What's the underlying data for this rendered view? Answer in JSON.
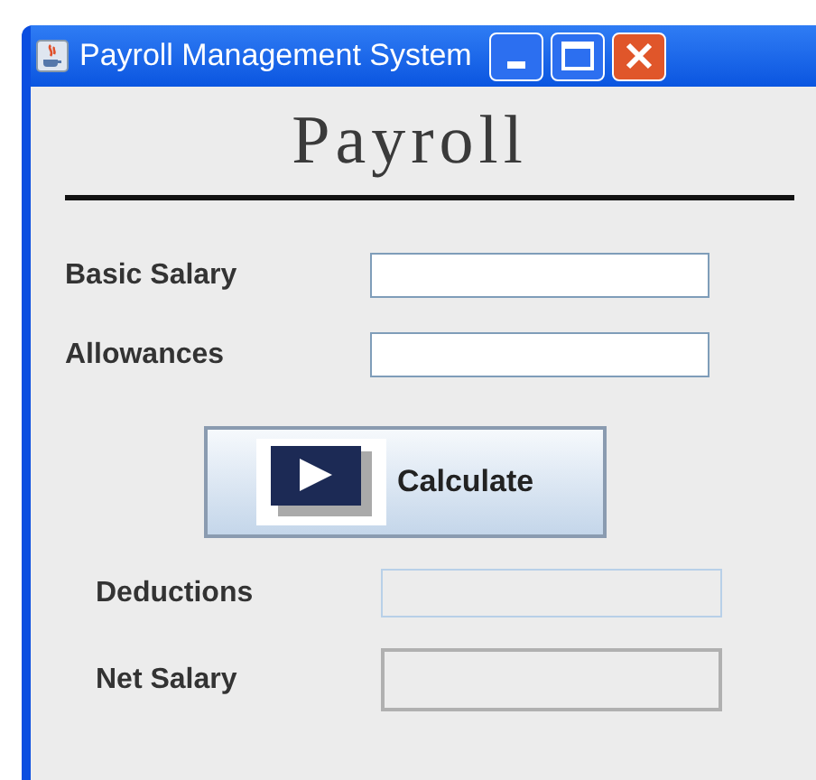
{
  "window": {
    "title": "Payroll Management System"
  },
  "heading": "Payroll",
  "inputs": [
    {
      "label": "Basic Salary",
      "editable": true
    },
    {
      "label": "Allowances",
      "editable": true
    }
  ],
  "button": {
    "label": "Calculate"
  },
  "outputs": [
    {
      "label": "Deductions",
      "editable": false,
      "focused": true
    },
    {
      "label": "Net Salary",
      "editable": false,
      "focused": false
    }
  ]
}
